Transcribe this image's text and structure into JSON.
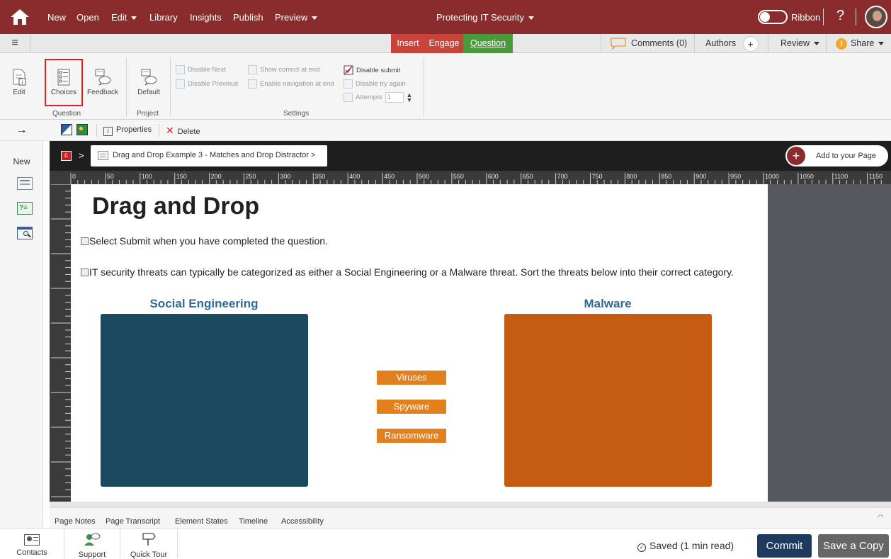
{
  "topbar": {
    "menu": [
      "New",
      "Open",
      "Edit",
      "Library",
      "Insights",
      "Publish",
      "Preview"
    ],
    "project_title": "Protecting IT Security",
    "ribbon_label": "Ribbon",
    "help_label": "?"
  },
  "bar2": {
    "modes": [
      "Insert",
      "Engage",
      "Question"
    ],
    "comments_label": "Comments (0)",
    "authors_label": "Authors",
    "review_label": "Review",
    "share_label": "Share"
  },
  "ribbon": {
    "edit_label": "Edit",
    "choices_label": "Choices",
    "feedback_label": "Feedback",
    "default_label": "Default",
    "group_question": "Question",
    "group_project": "Project",
    "group_settings": "Settings",
    "settings": {
      "disable_next": "Disable Next",
      "disable_previous": "Disable Previous",
      "show_correct": "Show correct at end",
      "enable_navigation": "Enable navigation at end",
      "disable_submit": "Disable submit",
      "disable_try_again": "Disable try again",
      "attempts_label": "Attempts",
      "attempts_value": "1"
    }
  },
  "toolbar3": {
    "properties_label": "Properties",
    "delete_label": "Delete"
  },
  "leftrail": {
    "new_label": "New"
  },
  "breadcrumb": {
    "root_symbol": "c",
    "separator": ">",
    "page_label": "Drag and Drop Example 3 - Matches and Drop Distractor >",
    "add_label": "Add to your Page"
  },
  "ruler_labels": [
    "0",
    "50",
    "100",
    "150",
    "200",
    "250",
    "300",
    "350",
    "400",
    "450",
    "500",
    "550",
    "600",
    "650",
    "700",
    "750",
    "800",
    "850",
    "900",
    "950",
    "1000",
    "1050",
    "1100",
    "1150"
  ],
  "page": {
    "title": "Drag and Drop",
    "instruction": "Select Submit when you have completed the question.",
    "question": "IT security threats can typically be categorized as either a Social Engineering or a Malware threat. Sort the threats below into their correct category.",
    "zone_left_label": "Social Engineering",
    "zone_right_label": "Malware",
    "items": [
      "Viruses",
      "Spyware",
      "Ransomware"
    ]
  },
  "colors": {
    "topbar": "#8a2c2e",
    "zone_left": "#1b4a5e",
    "zone_right": "#c55a11",
    "drag_item": "#e3801e",
    "commit": "#1e3a5f",
    "save_copy": "#666666",
    "question_mode": "#4a9a3c"
  },
  "tabs": [
    "Page Notes",
    "Page Transcript",
    "Element States",
    "Timeline",
    "Accessibility"
  ],
  "bottom": {
    "contacts_label": "Contacts",
    "support_label": "Support",
    "tour_label": "Quick Tour",
    "saved_label": "Saved (1 min read)",
    "commit_label": "Commit",
    "save_copy_label": "Save a Copy"
  }
}
